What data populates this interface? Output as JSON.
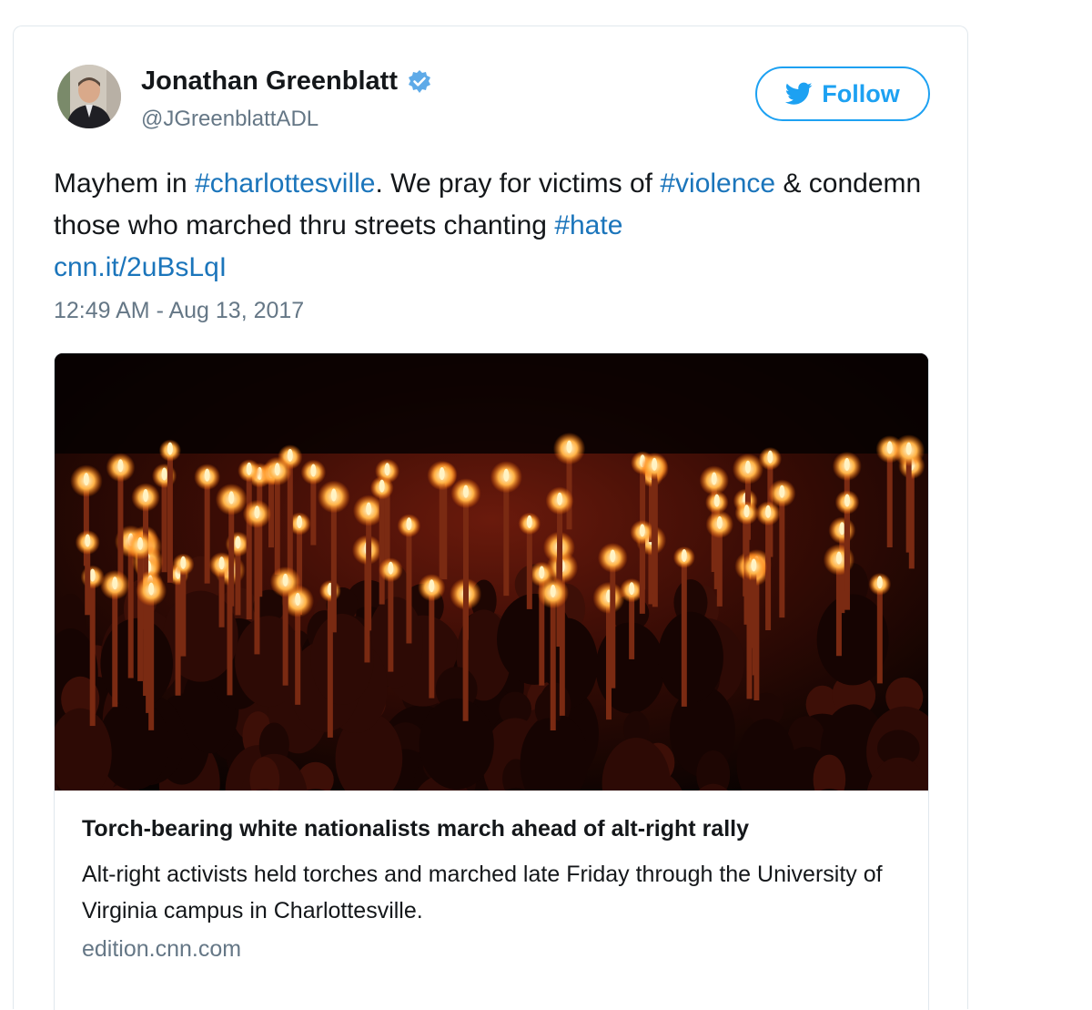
{
  "tweet": {
    "author_name": "Jonathan Greenblatt",
    "author_handle": "@JGreenblattADL",
    "verified_icon": "verified-badge-icon",
    "follow_label": "Follow",
    "follow_icon": "twitter-bird-icon",
    "text": {
      "part1": "Mayhem in ",
      "hashtag1": "#charlottesville",
      "part2": ". We pray for victims of ",
      "hashtag2": "#violence",
      "part3": " & condemn those who marched thru streets chanting ",
      "hashtag3": "#hate",
      "link": "cnn.it/2uBsLqI"
    },
    "timestamp": "12:49 AM - Aug 13, 2017"
  },
  "card": {
    "title": "Torch-bearing white nationalists march ahead of alt-right rally",
    "description": "Alt-right activists held torches and marched late Friday through the University of Virginia campus in Charlottesville.",
    "domain": "edition.cnn.com"
  },
  "colors": {
    "link": "#1b75bb",
    "accent": "#1da1f2",
    "text": "#14171a",
    "muted": "#657786"
  }
}
